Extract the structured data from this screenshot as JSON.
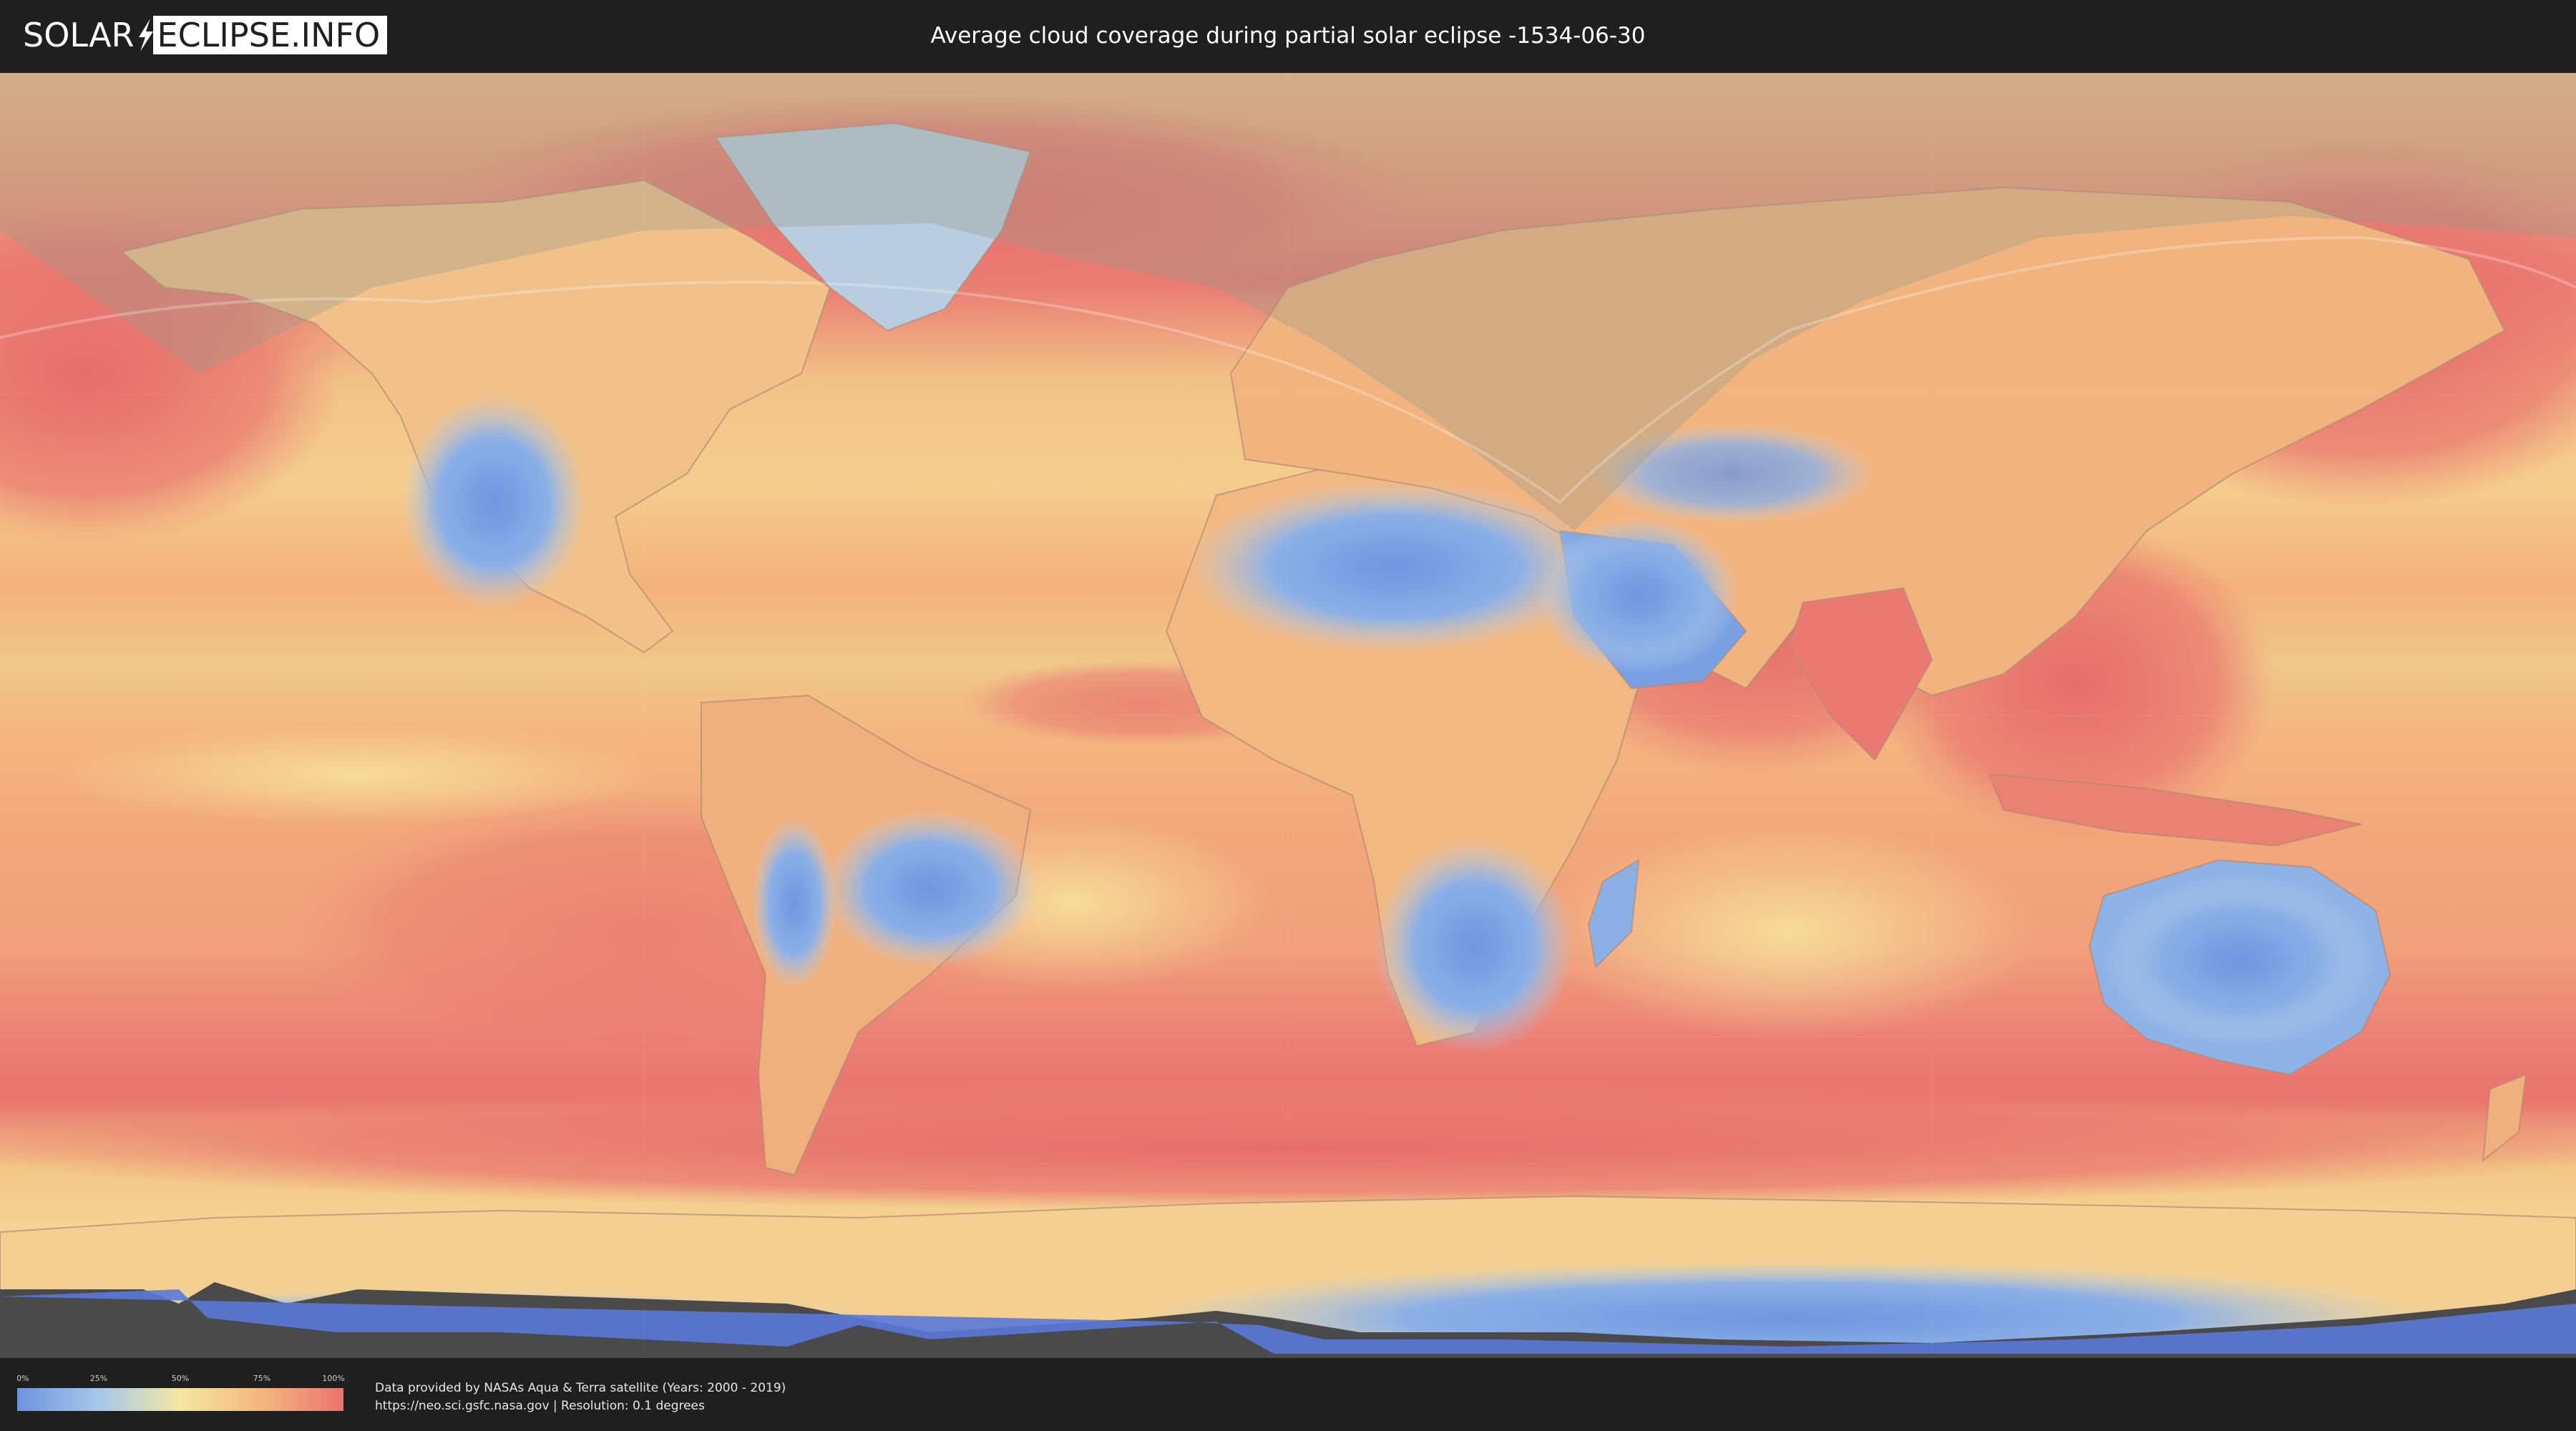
{
  "header": {
    "logo_part1": "SOLAR",
    "logo_part2": "ECLIPSE.INFO",
    "title": "Average cloud coverage during partial solar eclipse -1534-06-30"
  },
  "legend": {
    "ticks": [
      "0%",
      "25%",
      "50%",
      "75%",
      "100%"
    ],
    "colors": [
      "#6f93e0",
      "#a6c8ea",
      "#f4e6a2",
      "#f4b67d",
      "#ec7370"
    ]
  },
  "footer": {
    "credit_line1": "Data provided by NASAs Aqua & Terra satellite (Years: 2000 - 2019)",
    "credit_line2": "https://neo.sci.gsfc.nasa.gov | Resolution: 0.1 degrees"
  },
  "map": {
    "ocean_color": "#f0a07c",
    "clear_color": "#7aa0e4",
    "cloudy_color": "#ea7772",
    "eclipse_shadow_color": "#9a9a8a"
  }
}
